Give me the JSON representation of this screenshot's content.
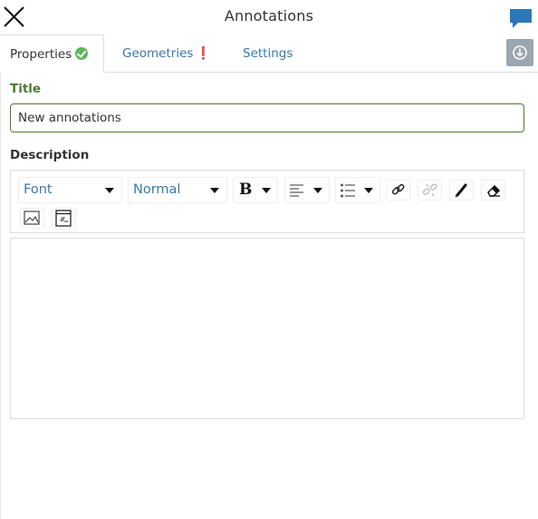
{
  "header": {
    "title": "Annotations",
    "close_icon": "close-icon",
    "chat_icon": "comment-icon"
  },
  "tabs": [
    {
      "label": "Properties",
      "status": "valid",
      "active": true
    },
    {
      "label": "Geometries",
      "status": "error",
      "status_glyph": "❗"
    },
    {
      "label": "Settings"
    }
  ],
  "form": {
    "title_label": "Title",
    "title_value": "New annotations",
    "description_label": "Description",
    "description_value": ""
  },
  "toolbar": {
    "font_label": "Font",
    "size_label": "Normal",
    "bold_glyph": "B",
    "icons": [
      "bold-icon",
      "align-icon",
      "list-icon",
      "link-icon",
      "unlink-icon",
      "pen-icon",
      "eraser-icon",
      "image-icon",
      "code-icon"
    ]
  },
  "colors": {
    "accent_green": "#4c7a34",
    "link_blue": "#3a78a8",
    "success": "#5cb85c",
    "error": "#c9302c",
    "chat_blue": "#2b78b8"
  }
}
